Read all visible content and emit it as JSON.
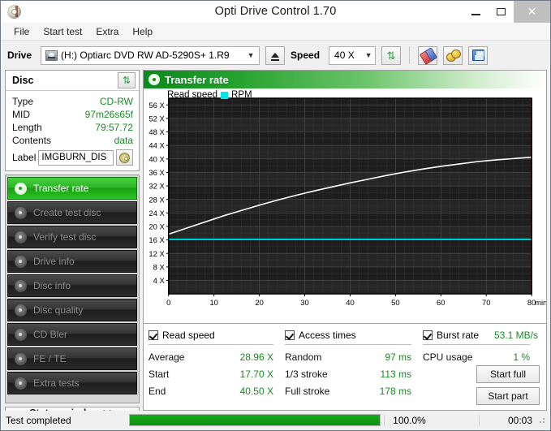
{
  "window": {
    "title": "Opti Drive Control 1.70",
    "app_icon": "disc-icon",
    "minimize": "minimize-icon",
    "maximize": "maximize-icon",
    "close": "✕"
  },
  "menu": {
    "items": [
      "File",
      "Start test",
      "Extra",
      "Help"
    ]
  },
  "toolbar": {
    "drive_label": "Drive",
    "drive_value": "(H:)  Optiarc DVD RW AD-5290S+ 1.R9",
    "eject_icon": "eject-icon",
    "speed_label": "Speed",
    "speed_value": "40 X",
    "refresh_icon": "refresh-icon",
    "eraser_icon": "eraser-icon",
    "coins_icon": "coins-icon",
    "save_icon": "save-icon"
  },
  "disc": {
    "header": "Disc",
    "refresh_icon": "refresh-icon",
    "rows": [
      {
        "key": "Type",
        "value": "CD-RW"
      },
      {
        "key": "MID",
        "value": "97m26s65f"
      },
      {
        "key": "Length",
        "value": "79:57.72"
      },
      {
        "key": "Contents",
        "value": "data"
      }
    ],
    "label_key": "Label",
    "label_value": "IMGBURN_DIS",
    "label_button_icon": "cd-icon"
  },
  "nav": {
    "items": [
      {
        "label": "Transfer rate",
        "active": true
      },
      {
        "label": "Create test disc",
        "active": false
      },
      {
        "label": "Verify test disc",
        "active": false
      },
      {
        "label": "Drive info",
        "active": false
      },
      {
        "label": "Disc info",
        "active": false
      },
      {
        "label": "Disc quality",
        "active": false
      },
      {
        "label": "CD Bler",
        "active": false
      },
      {
        "label": "FE / TE",
        "active": false
      },
      {
        "label": "Extra tests",
        "active": false
      }
    ],
    "status_window": "Status window >>"
  },
  "chart_panel": {
    "title": "Transfer rate",
    "icon": "disc-icon"
  },
  "chart_data": {
    "type": "line",
    "title": "Transfer rate",
    "xlabel": "min",
    "ylabel": "X",
    "xlim": [
      0,
      80
    ],
    "ylim": [
      0,
      58
    ],
    "x_ticks": [
      0,
      10,
      20,
      30,
      40,
      50,
      60,
      70,
      80
    ],
    "y_ticks": [
      4,
      8,
      12,
      16,
      20,
      24,
      28,
      32,
      36,
      40,
      44,
      48,
      52,
      56
    ],
    "y_tick_suffix": "X",
    "x_unit_label": "min",
    "grid": true,
    "plot_bg": "#1e1e1e",
    "legend": [
      {
        "name": "Read speed",
        "color": "#ffffff",
        "swatch": false
      },
      {
        "name": "RPM",
        "color": "#00e5e5",
        "swatch": true
      }
    ],
    "series": [
      {
        "name": "Read speed",
        "color": "#ffffff",
        "x": [
          0,
          2,
          4,
          6,
          8,
          10,
          12,
          14,
          16,
          18,
          20,
          24,
          28,
          32,
          36,
          40,
          44,
          48,
          52,
          56,
          60,
          64,
          68,
          72,
          76,
          80
        ],
        "values": [
          17.7,
          18.6,
          19.5,
          20.4,
          21.3,
          22.2,
          23.1,
          23.9,
          24.7,
          25.5,
          26.3,
          27.8,
          29.2,
          30.5,
          31.7,
          32.9,
          34.0,
          35.1,
          36.1,
          37.0,
          37.8,
          38.5,
          39.2,
          39.7,
          40.1,
          40.5
        ]
      },
      {
        "name": "RPM",
        "color": "#00e5e5",
        "x": [
          0,
          80
        ],
        "values": [
          16.2,
          16.2
        ]
      }
    ],
    "end_marker": {
      "x": 80,
      "color": "#c01818"
    }
  },
  "stats": {
    "read_speed": {
      "checkbox_label": "Read speed",
      "checked": true,
      "rows": [
        {
          "key": "Average",
          "value": "28.96 X"
        },
        {
          "key": "Start",
          "value": "17.70 X"
        },
        {
          "key": "End",
          "value": "40.50 X"
        }
      ]
    },
    "access_times": {
      "checkbox_label": "Access times",
      "checked": true,
      "rows": [
        {
          "key": "Random",
          "value": "97 ms"
        },
        {
          "key": "1/3 stroke",
          "value": "113 ms"
        },
        {
          "key": "Full stroke",
          "value": "178 ms"
        }
      ]
    },
    "burst": {
      "checkbox_label": "Burst rate",
      "checked": true,
      "burst_value": "53.1 MB/s",
      "rows": [
        {
          "key": "CPU usage",
          "value": "1 %"
        }
      ],
      "buttons": [
        "Start full",
        "Start part"
      ]
    }
  },
  "statusbar": {
    "message": "Test completed",
    "progress_percent": 100,
    "progress_label": "100.0%",
    "elapsed": "00:03"
  }
}
